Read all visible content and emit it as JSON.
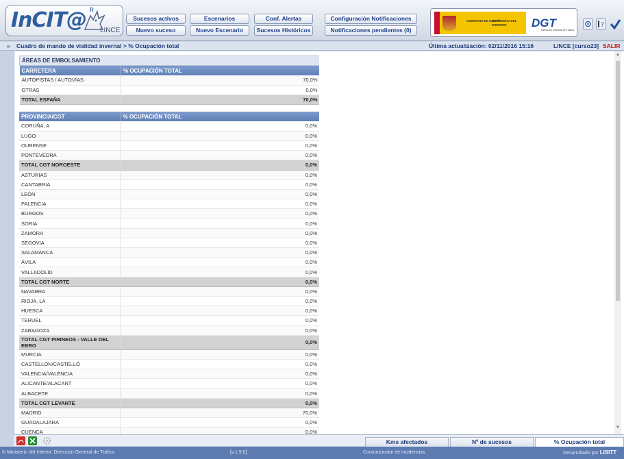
{
  "app": {
    "logo_text": "InCIT@",
    "logo_sub": "LINCE",
    "logo_reg": "R"
  },
  "nav": {
    "sucesos_activos": "Sucesos activos",
    "nuevo_suceso": "Nuevo suceso",
    "escenarios": "Escenarios",
    "nuevo_escenario": "Nuevo Escenario",
    "conf_alertas": "Conf. Alertas",
    "sucesos_historicos": "Sucesos Históricos",
    "conf_notificaciones": "Configuración Notificaciones",
    "notificaciones_pendientes": "Notificaciones pendientes (0)"
  },
  "gov": {
    "gobierno": "GOBIERNO DE ESPAÑA",
    "ministerio": "MINISTERIO DEL INTERIOR",
    "dgt": "DGT",
    "dgt_sub": "Dirección General de Tráfico"
  },
  "header_icons": [
    "settings-icon",
    "help-icon",
    "check-icon"
  ],
  "crumbbar": {
    "arrow": "»",
    "breadcrumb": "Cuadro de mando de vialidad invernal > % Ocupación total",
    "last_update": "Última actualización: 02/11/2016 15:16",
    "user": "LINCE [curso23]",
    "logout": "SALIR"
  },
  "areas": {
    "section_title": "ÁREAS DE EMBOLSAMIENTO",
    "col1": "CARRETERA",
    "col2": "% OCUPACIÓN TOTAL",
    "rows": [
      {
        "name": "AUTOPISTAS / AUTOVÍAS",
        "value": "70,0%",
        "total": false
      },
      {
        "name": "OTRAS",
        "value": "0,0%",
        "total": false
      },
      {
        "name": "TOTAL ESPAÑA",
        "value": "70,0%",
        "total": true
      }
    ]
  },
  "provincias": {
    "col1": "PROVINCIA/CGT",
    "col2": "% OCUPACIÓN TOTAL",
    "rows": [
      {
        "name": "CORUÑA, A",
        "value": "0,0%",
        "total": false
      },
      {
        "name": "LUGO",
        "value": "0,0%",
        "total": false
      },
      {
        "name": "OURENSE",
        "value": "0,0%",
        "total": false
      },
      {
        "name": "PONTEVEDRA",
        "value": "0,0%",
        "total": false
      },
      {
        "name": "TOTAL CGT NOROESTE",
        "value": "0,0%",
        "total": true
      },
      {
        "name": "ASTURIAS",
        "value": "0,0%",
        "total": false
      },
      {
        "name": "CANTABRIA",
        "value": "0,0%",
        "total": false
      },
      {
        "name": "LEÓN",
        "value": "0,0%",
        "total": false
      },
      {
        "name": "PALENCIA",
        "value": "0,0%",
        "total": false
      },
      {
        "name": "BURGOS",
        "value": "0,0%",
        "total": false
      },
      {
        "name": "SORIA",
        "value": "0,0%",
        "total": false
      },
      {
        "name": "ZAMORA",
        "value": "0,0%",
        "total": false
      },
      {
        "name": "SEGOVIA",
        "value": "0,0%",
        "total": false
      },
      {
        "name": "SALAMANCA",
        "value": "0,0%",
        "total": false
      },
      {
        "name": "ÁVILA",
        "value": "0,0%",
        "total": false
      },
      {
        "name": "VALLADOLID",
        "value": "0,0%",
        "total": false
      },
      {
        "name": "TOTAL CGT NORTE",
        "value": "0,0%",
        "total": true
      },
      {
        "name": "NAVARRA",
        "value": "0,0%",
        "total": false
      },
      {
        "name": "RIOJA, LA",
        "value": "0,0%",
        "total": false
      },
      {
        "name": "HUESCA",
        "value": "0,0%",
        "total": false
      },
      {
        "name": "TERUEL",
        "value": "0,0%",
        "total": false
      },
      {
        "name": "ZARAGOZA",
        "value": "0,0%",
        "total": false
      },
      {
        "name": "TOTAL CGT PIRINEOS - VALLE DEL EBRO",
        "value": "0,0%",
        "total": true
      },
      {
        "name": "MURCIA",
        "value": "0,0%",
        "total": false
      },
      {
        "name": "CASTELLÓN/CASTELLÓ",
        "value": "0,0%",
        "total": false
      },
      {
        "name": "VALENCIA/VALÈNCIA",
        "value": "0,0%",
        "total": false
      },
      {
        "name": "ALICANTE/ALACANT",
        "value": "0,0%",
        "total": false
      },
      {
        "name": "ALBACETE",
        "value": "0,0%",
        "total": false
      },
      {
        "name": "TOTAL CGT LEVANTE",
        "value": "0,0%",
        "total": true
      },
      {
        "name": "MADRID",
        "value": "70,0%",
        "total": false
      },
      {
        "name": "GUADALAJARA",
        "value": "0,0%",
        "total": false
      },
      {
        "name": "CUENCA",
        "value": "0,0%",
        "total": false
      }
    ]
  },
  "bottom": {
    "icons": [
      "pdf-icon",
      "excel-icon",
      "gear-icon"
    ],
    "tab_kms": "Kms afectados",
    "tab_sucesos": "Nº de sucesos",
    "tab_ocupacion": "% Ocupación total"
  },
  "footer": {
    "copyright": "© Ministerio del Interior. Dirección General de Tráfico",
    "version": "[v.1.9.0]",
    "app_name": "Comunicación de incidencias",
    "developed_by": "Desarrollado por",
    "developer": "LISITT"
  },
  "colors": {
    "header_blue": "#5e7fb6",
    "total_row": "#d2d2d2",
    "logout_red": "#d01010",
    "footer": "#5c7bb1"
  }
}
